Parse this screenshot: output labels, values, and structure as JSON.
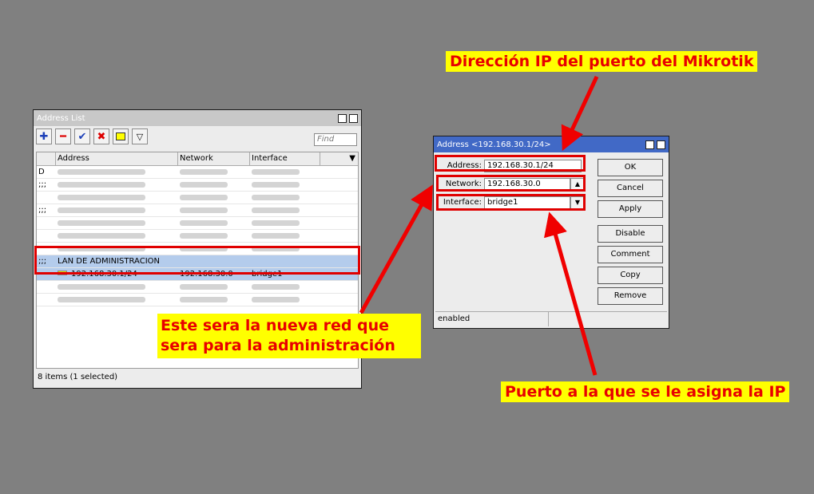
{
  "address_list": {
    "title": "Address List",
    "find_placeholder": "Find",
    "columns": [
      "Address",
      "Network",
      "Interface"
    ],
    "rows": [
      {
        "flag": "D",
        "address": "",
        "network": "",
        "interface": "",
        "blurred": true
      },
      {
        "flag": ";;;",
        "address": "",
        "network": "",
        "interface": "",
        "blurred": true,
        "comment": true
      },
      {
        "flag": "",
        "address": "",
        "network": "",
        "interface": "",
        "blurred": true
      },
      {
        "flag": ";;;",
        "address": "",
        "network": "",
        "interface": "",
        "blurred": true,
        "comment": true
      },
      {
        "flag": "",
        "address": "",
        "network": "",
        "interface": "",
        "blurred": true
      },
      {
        "flag": "",
        "address": "",
        "network": "",
        "interface": "",
        "blurred": true
      },
      {
        "flag": "",
        "address": "",
        "network": "",
        "interface": "",
        "blurred": true
      },
      {
        "flag": ";;;",
        "comment_text": "LAN DE ADMINISTRACION",
        "selected": true
      },
      {
        "flag": "",
        "address": "192.168.30.1/24",
        "network": "192.168.30.0",
        "interface": "bridge1",
        "selected": true
      },
      {
        "flag": "",
        "address": "",
        "network": "",
        "interface": "",
        "blurred": true
      },
      {
        "flag": "",
        "address": "",
        "network": "",
        "interface": "",
        "blurred": true
      }
    ],
    "status": "8 items (1 selected)"
  },
  "dialog": {
    "title": "Address <192.168.30.1/24>",
    "address_label": "Address:",
    "address_value": "192.168.30.1/24",
    "network_label": "Network:",
    "network_value": "192.168.30.0",
    "interface_label": "Interface:",
    "interface_value": "bridge1",
    "buttons": [
      "OK",
      "Cancel",
      "Apply",
      "Disable",
      "Comment",
      "Copy",
      "Remove"
    ],
    "status": "enabled"
  },
  "annotations": {
    "top": "Dirección IP del puerto del Mikrotik",
    "left_line1": "Este sera la nueva red que",
    "left_line2": "sera para la administración",
    "bottom": "Puerto a la que se le asigna la IP"
  },
  "colors": {
    "annotation_bg": "#FFFF00",
    "annotation_text": "#E80000",
    "selection": "#B4CCEC",
    "dialog_titlebar": "#4169C6"
  }
}
